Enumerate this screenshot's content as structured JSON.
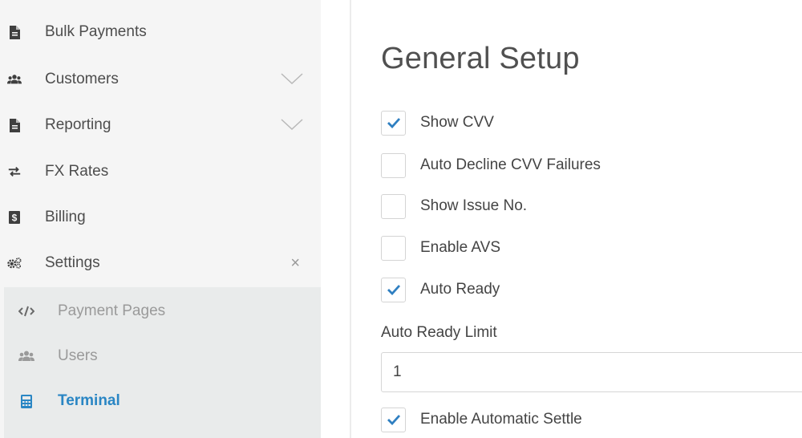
{
  "sidebar": {
    "items": [
      {
        "label": "Bulk Payments",
        "icon": "file-icon"
      },
      {
        "label": "Customers",
        "icon": "users-icon",
        "expandable": true
      },
      {
        "label": "Reporting",
        "icon": "file-icon",
        "expandable": true
      },
      {
        "label": "FX Rates",
        "icon": "exchange-icon"
      },
      {
        "label": "Billing",
        "icon": "dollar-icon"
      },
      {
        "label": "Settings",
        "icon": "cogs-icon",
        "expanded": true
      }
    ],
    "settings_close_glyph": "×",
    "subitems": [
      {
        "label": "Payment Pages",
        "icon": "code-icon"
      },
      {
        "label": "Users",
        "icon": "users-icon"
      },
      {
        "label": "Terminal",
        "icon": "calculator-icon",
        "active": true
      }
    ]
  },
  "main": {
    "title": "General Setup",
    "checkboxes": [
      {
        "label": "Show CVV",
        "checked": true
      },
      {
        "label": "Auto Decline CVV Failures",
        "checked": false
      },
      {
        "label": "Show Issue No.",
        "checked": false
      },
      {
        "label": "Enable AVS",
        "checked": false
      },
      {
        "label": "Auto Ready",
        "checked": true
      }
    ],
    "auto_ready_limit": {
      "label": "Auto Ready Limit",
      "value": "1"
    },
    "settle_checkbox": {
      "label": "Enable Automatic Settle",
      "checked": true
    }
  },
  "colors": {
    "accent": "#2a86c4",
    "sidebar_bg": "#f5f5f5",
    "submenu_bg": "#e9ebeb",
    "check": "#2f7fc1"
  }
}
